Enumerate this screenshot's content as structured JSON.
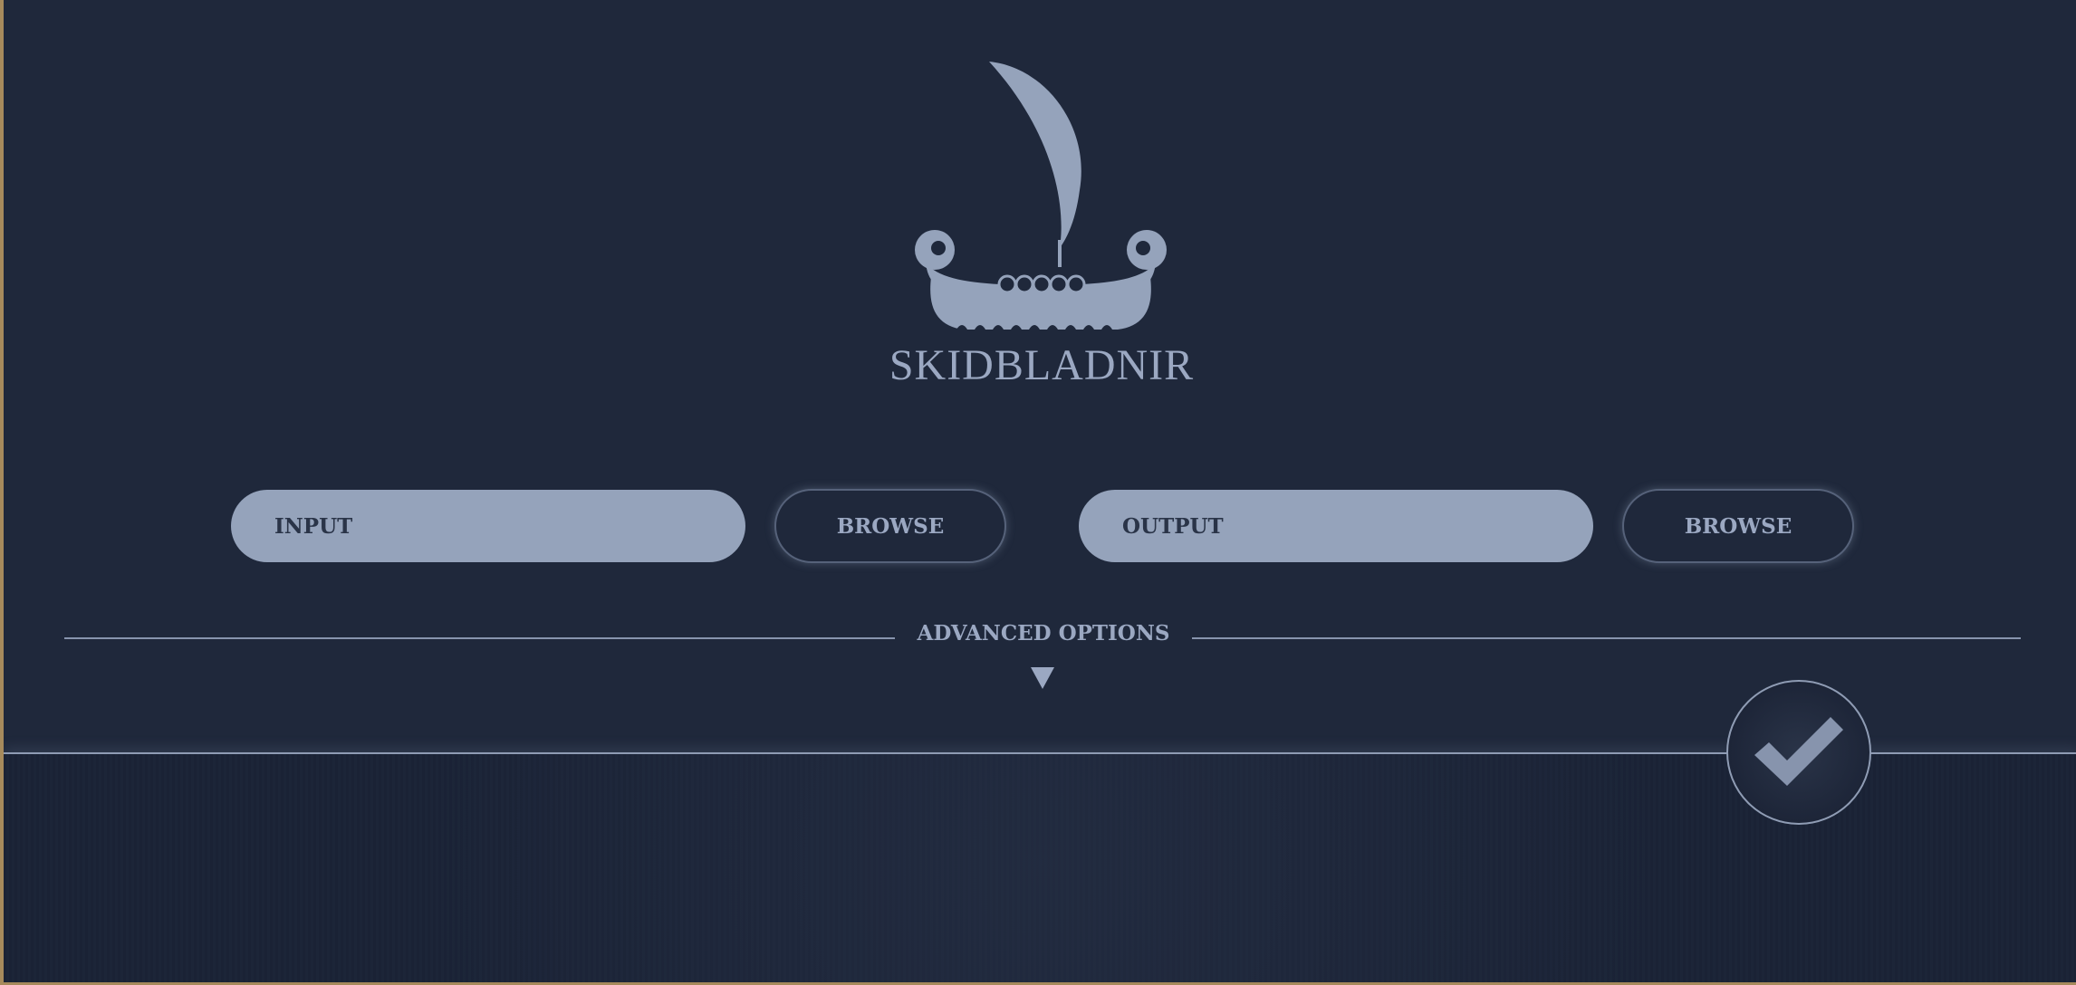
{
  "app": {
    "title": "SKIDBLADNIR"
  },
  "io": {
    "input_placeholder": "INPUT",
    "output_placeholder": "OUTPUT",
    "browse_label": "BROWSE"
  },
  "advanced": {
    "label": "ADVANCED OPTIONS"
  },
  "icons": {
    "logo": "viking-longship-icon",
    "toggle": "triangle-down-icon",
    "confirm": "checkmark-icon"
  },
  "colors": {
    "background": "#1f283b",
    "accent": "#95a3bb",
    "text": "#9ba8c2",
    "bottom_panel": "#1a2235",
    "frame_border": "#a68a5c"
  }
}
